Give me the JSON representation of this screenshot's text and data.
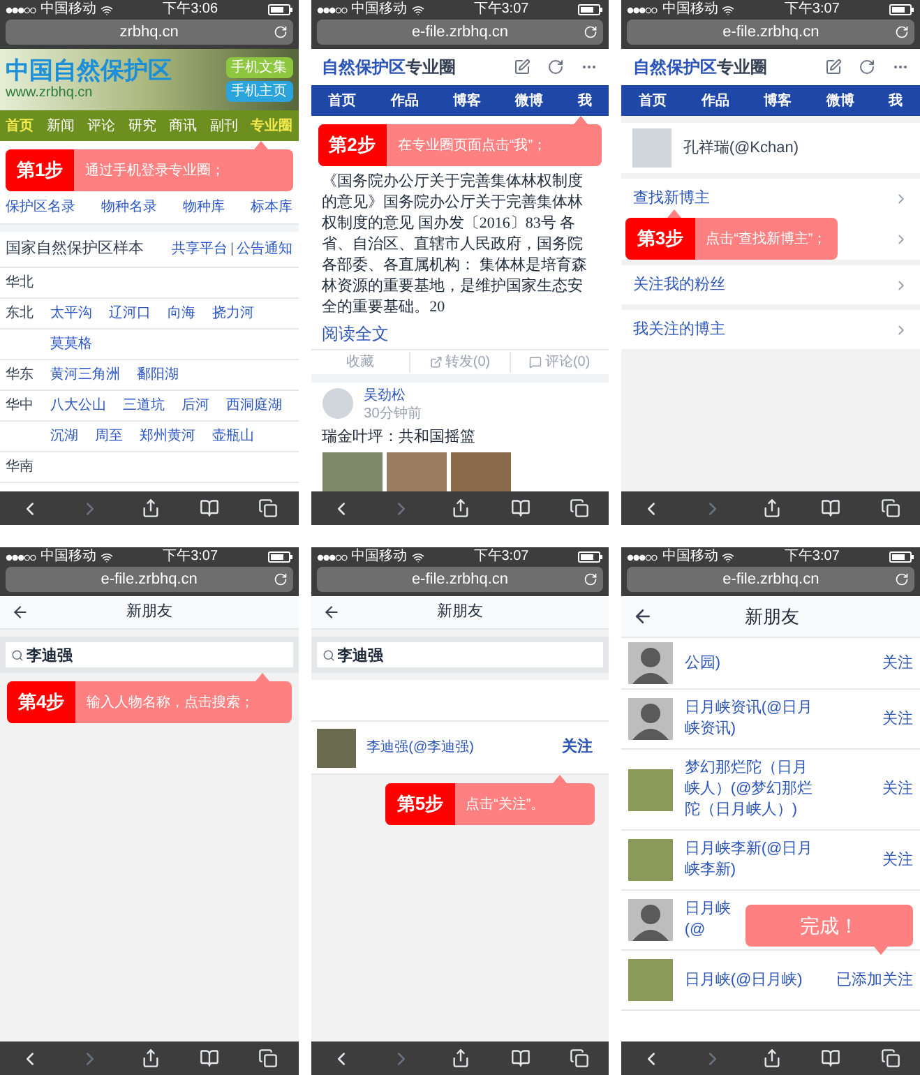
{
  "panels": [
    {
      "kind": "home",
      "status": {
        "carrier": "中国移动",
        "time": "下午3:06"
      },
      "url": "zrbhq.cn",
      "banner": {
        "logo": "中国自然保护区",
        "site": "www.zrbhq.cn",
        "buttons": [
          {
            "label": "手机文集",
            "color": "#8dc63f"
          },
          {
            "label": "手机主页",
            "color": "#2ba3dc"
          }
        ]
      },
      "nav": [
        {
          "label": "首页",
          "highlighted": true
        },
        {
          "label": "新闻",
          "highlighted": false
        },
        {
          "label": "评论",
          "highlighted": false
        },
        {
          "label": "研究",
          "highlighted": false
        },
        {
          "label": "商讯",
          "highlighted": false
        },
        {
          "label": "副刊",
          "highlighted": false
        },
        {
          "label": "专业圈",
          "highlighted": true
        }
      ],
      "callout": {
        "step": "第1步",
        "text": "通过手机登录专业圈；"
      },
      "quick_links": [
        "保护区名录",
        "物种名录",
        "物种库",
        "标本库"
      ],
      "section": {
        "title": "国家自然保护区样本",
        "links": [
          "共享平台",
          "公告通知"
        ],
        "separator": "|"
      },
      "regions": [
        {
          "region": "华北"
        },
        {
          "region": "东北",
          "links": [
            "太平沟",
            "辽河口",
            "向海",
            "挠力河"
          ]
        },
        {
          "links": [
            "莫莫格"
          ]
        },
        {
          "region": "华东",
          "links": [
            "黄河三角洲",
            "鄱阳湖"
          ]
        },
        {
          "region": "华中",
          "links": [
            "八大公山",
            "三道坑",
            "后河",
            "西洞庭湖"
          ]
        },
        {
          "links": [
            "沉湖",
            "周至",
            "郑州黄河",
            "壶瓶山"
          ]
        },
        {
          "region": "华南"
        }
      ]
    },
    {
      "kind": "feed",
      "status": {
        "carrier": "中国移动",
        "time": "下午3:07"
      },
      "url": "e-file.zrbhq.cn",
      "header": {
        "brand": "自然保护区",
        "suffix": "专业圈"
      },
      "nav": [
        "首页",
        "作品",
        "博客",
        "微博",
        "我"
      ],
      "callout": {
        "step": "第2步",
        "text": "在专业圈页面点击“我”；"
      },
      "post": {
        "text": "《国务院办公厅关于完善集体林权制度的意见》国务院办公厅关于完善集体林权制度的意见 国办发〔2016〕83号 各省、自治区、直辖市人民政府，国务院各部委、各直属机构： 集体林是培育森林资源的重要基地，是维护国家生态安全的重要基础。20",
        "more": "阅读全文",
        "actions": [
          "收藏",
          "转发(0)",
          "评论(0)"
        ]
      },
      "next_post": {
        "author": "吴劲松",
        "time": "30分钟前",
        "title": "瑞金叶坪：共和国摇篮"
      }
    },
    {
      "kind": "me",
      "status": {
        "carrier": "中国移动",
        "time": "下午3:07"
      },
      "url": "e-file.zrbhq.cn",
      "header": {
        "brand": "自然保护区",
        "suffix": "专业圈"
      },
      "nav": [
        "首页",
        "作品",
        "博客",
        "微博",
        "我"
      ],
      "profile": {
        "name": "孔祥瑞(@Kchan)"
      },
      "menu": [
        "查找新博主",
        "关注我的粉丝",
        "我关注的博主"
      ],
      "callout": {
        "step": "第3步",
        "text": "点击“查找新博主”；"
      }
    },
    {
      "kind": "search",
      "status": {
        "carrier": "中国移动",
        "time": "下午3:07"
      },
      "url": "e-file.zrbhq.cn",
      "title": "新朋友",
      "search": {
        "value": "李迪强"
      },
      "callout": {
        "step": "第4步",
        "text": "输入人物名称，点击搜索；"
      }
    },
    {
      "kind": "results",
      "status": {
        "carrier": "中国移动",
        "time": "下午3:07"
      },
      "url": "e-file.zrbhq.cn",
      "title": "新朋友",
      "search": {
        "value": "李迪强"
      },
      "results": [
        {
          "name": "李迪强(@李迪强)",
          "action": "关注"
        }
      ],
      "callout": {
        "step": "第5步",
        "text": "点击“关注”。"
      }
    },
    {
      "kind": "list",
      "status": {
        "carrier": "中国移动",
        "time": "下午3:07"
      },
      "url": "e-file.zrbhq.cn",
      "title": "新朋友",
      "users": [
        {
          "kind": "placeholder",
          "name": "公园)",
          "action": "关注"
        },
        {
          "kind": "placeholder",
          "name": "日月峡资讯(@日月峡资讯)",
          "action": "关注"
        },
        {
          "kind": "photo",
          "name": "梦幻那烂陀（日月峡人）(@梦幻那烂陀（日月峡人）)",
          "action": "关注"
        },
        {
          "kind": "photo",
          "name": "日月峡李新(@日月峡李新)",
          "action": "关注"
        },
        {
          "kind": "placeholder",
          "name": "日月峡(@"
        },
        {
          "kind": "photo",
          "name": "日月峡(@日月峡)",
          "action": "已添加关注"
        }
      ],
      "callout": {
        "text": "完成！"
      }
    }
  ]
}
